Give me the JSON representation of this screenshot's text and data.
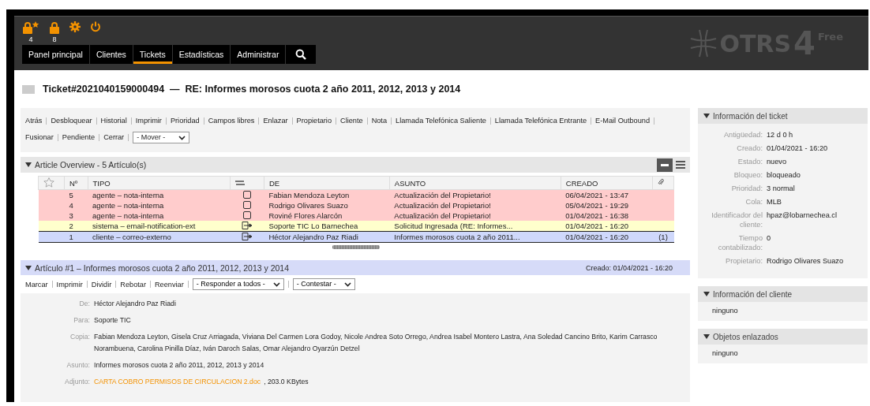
{
  "header": {
    "toolbar": [
      {
        "kind": "lock-star",
        "count": "4"
      },
      {
        "kind": "lock",
        "count": "8"
      },
      {
        "kind": "gear"
      },
      {
        "kind": "power"
      }
    ],
    "nav": [
      {
        "label": "Panel principal",
        "selected": false
      },
      {
        "label": "Clientes",
        "selected": false
      },
      {
        "label": "Tickets",
        "selected": true
      },
      {
        "label": "Estadísticas",
        "selected": false
      },
      {
        "label": "Administrar",
        "selected": false
      }
    ],
    "logo": {
      "name": "OTRS",
      "version": "4",
      "edition": "Free"
    }
  },
  "ticket_title": "Ticket#2021040159000494  —  RE: Informes morosos cuota 2 año 2011, 2012, 2013 y 2014",
  "actions": [
    "Atrás",
    "Desbloquear",
    "Historial",
    "Imprimir",
    "Prioridad",
    "Campos libres",
    "Enlazar",
    "Propietario",
    "Cliente",
    "Nota",
    "Llamada Telefónica Saliente",
    "Llamada Telefónica Entrante",
    "E-Mail Outbound",
    "Fusionar",
    "Pendiente",
    "Cerrar"
  ],
  "move_select": "- Mover -",
  "article_overview": {
    "title": "Article Overview - 5 Artículo(s)",
    "columns": [
      "Nº",
      "TIPO",
      "DE",
      "ASUNTO",
      "CREADO"
    ],
    "rows": [
      {
        "kind": "internal",
        "selected": false,
        "number": "5",
        "type": "agente – nota-interna",
        "from": "Fabian Mendoza Leyton",
        "subject": "Actualización del Propietario!",
        "created": "06/04/2021 - 13:47"
      },
      {
        "kind": "internal",
        "selected": false,
        "number": "4",
        "type": "agente – nota-interna",
        "from": "Rodrigo Olivares Suazo",
        "subject": "Actualización del Propietario!",
        "created": "05/04/2021 - 19:29"
      },
      {
        "kind": "internal",
        "selected": false,
        "number": "3",
        "type": "agente – nota-interna",
        "from": "Roviné Flores Alarcón",
        "subject": "Actualización del Propietario!",
        "created": "01/04/2021 - 16:38"
      },
      {
        "kind": "system",
        "selected": false,
        "number": "2",
        "type": "sistema – email-notification-ext",
        "from": "Soporte TIC Lo Barnechea",
        "subject": "Solicitud Ingresada (RE: Informes...",
        "created": "01/04/2021 - 16:20"
      },
      {
        "kind": "customer",
        "selected": true,
        "number": "1",
        "type": "cliente – correo-externo",
        "from": "Héctor Alejandro Paz Riadi",
        "subject": "Informes morosos cuota 2 año 2011...",
        "created": "01/04/2021 - 16:20",
        "attachments": "(1)"
      }
    ]
  },
  "article": {
    "title": "Artículo #1 – Informes morosos cuota 2 año 2011, 2012, 2013 y 2014",
    "created": "Creado: 01/04/2021 - 16:20",
    "actions": [
      "Marcar",
      "Imprimir",
      "Dividir",
      "Rebotar",
      "Reenviar"
    ],
    "selects": [
      "- Responder a todos -",
      "- Contestar -"
    ],
    "fields": [
      {
        "label": "De:",
        "value": "Héctor Alejandro Paz Riadi"
      },
      {
        "label": "Para:",
        "value": "Soporte TIC"
      },
      {
        "label": "Copia:",
        "value": "Fabian Mendoza Leyton, Gisela Cruz Arriagada, Viviana Del Carmen Lora Godoy, Nicole Andrea Soto Orrego, Andrea Isabel Montero Lastra, Ana Soledad Cancino Brito, Karim Carrasco Norambuena, Carolina Pinilla Díaz, Iván Daroch Salas, Omar Alejandro Oyarzún Detzel"
      },
      {
        "label": "Asunto:",
        "value": "Informes morosos cuota 2 año 2011, 2012, 2013 y 2014"
      },
      {
        "label": "Adjunto:",
        "link": "CARTA COBRO PERMISOS DE CIRCULACION 2.doc",
        "value": ", 203.0 KBytes"
      }
    ]
  },
  "sidebar": [
    {
      "title": "Información del ticket",
      "fields": [
        {
          "label": "Antigüedad:",
          "value": "12 d 0 h"
        },
        {
          "label": "Creado:",
          "value": "01/04/2021 - 16:20"
        },
        {
          "label": "Estado:",
          "value": "nuevo"
        },
        {
          "label": "Bloqueo:",
          "value": "bloqueado"
        },
        {
          "label": "Prioridad:",
          "value": "3 normal"
        },
        {
          "label": "Cola:",
          "value": "MLB"
        },
        {
          "label": "Identificador del cliente:",
          "link": "hpaz@lobarnechea.cl"
        },
        {
          "label": "Tiempo contabilizado:",
          "value": "0"
        },
        {
          "label": "Propietario:",
          "value": "Rodrigo Olivares Suazo"
        }
      ]
    },
    {
      "title": "Información del cliente",
      "text": "ninguno"
    },
    {
      "title": "Objetos enlazados",
      "text": "ninguno"
    }
  ]
}
